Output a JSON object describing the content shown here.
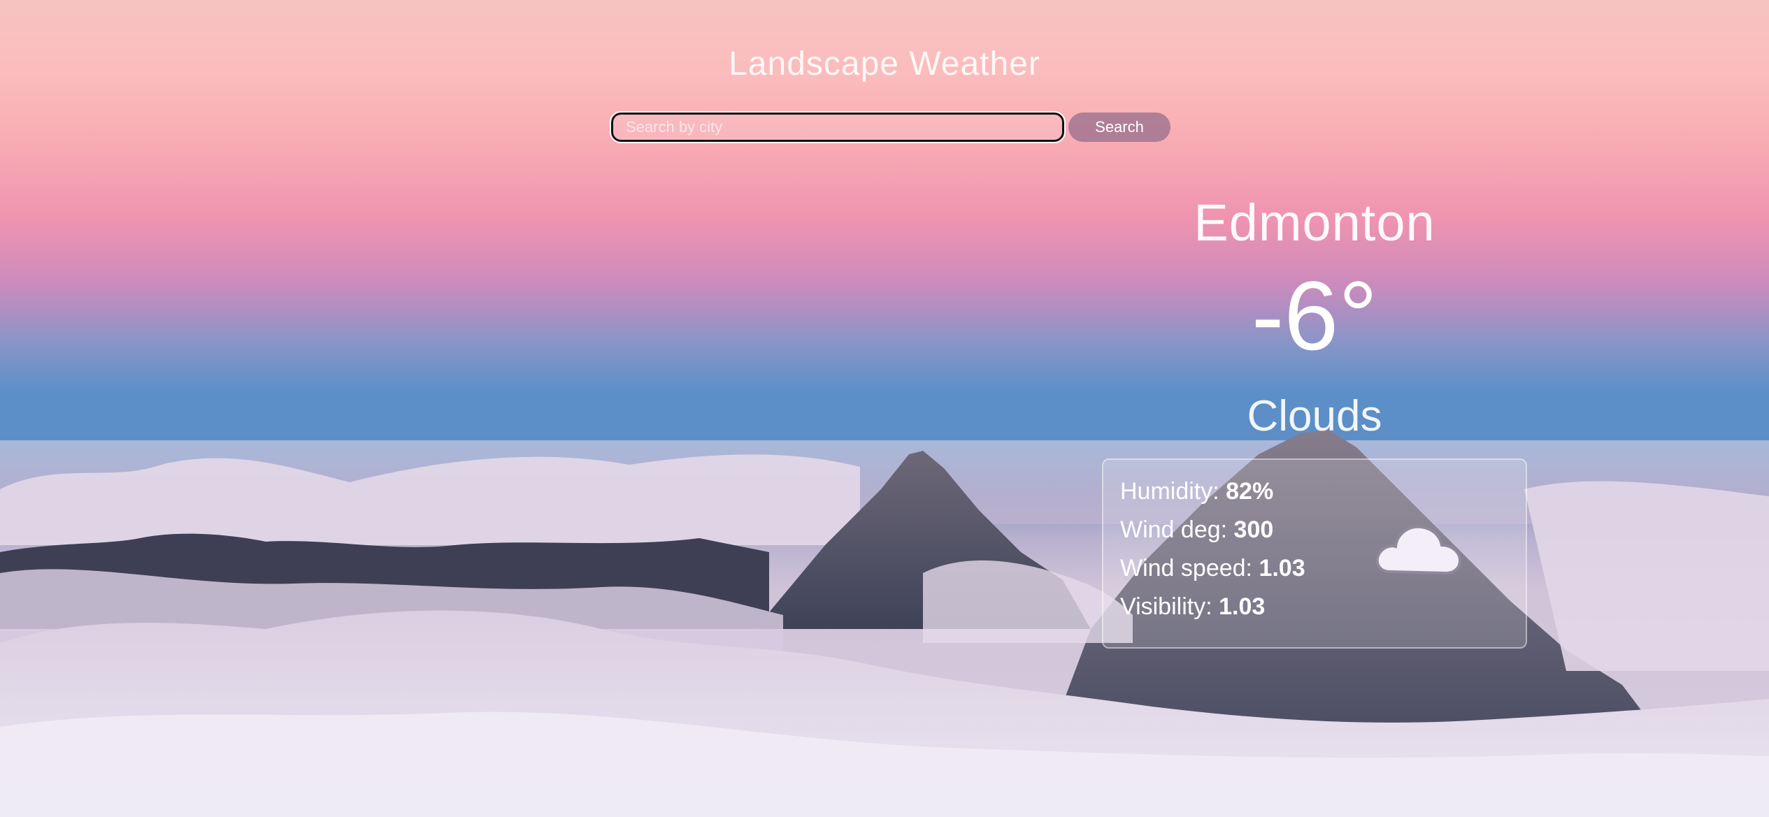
{
  "app": {
    "title": "Landscape Weather"
  },
  "search": {
    "placeholder": "Search by city",
    "value": "",
    "button_label": "Search"
  },
  "weather": {
    "city": "Edmonton",
    "temperature": "-6°",
    "condition": "Clouds",
    "condition_icon": "cloud-icon",
    "details": [
      {
        "label": "Humidity: ",
        "value": "82%"
      },
      {
        "label": "Wind deg: ",
        "value": "300"
      },
      {
        "label": "Wind speed: ",
        "value": "1.03"
      },
      {
        "label": "Visibility: ",
        "value": "1.03"
      }
    ]
  },
  "colors": {
    "sky_top": "#f7c3c2",
    "sky_mid": "#ef93b0",
    "sky_blue": "#5c8fc8",
    "clouds": "#d8cde0",
    "card_cloud_icon": "#f3eef7"
  }
}
